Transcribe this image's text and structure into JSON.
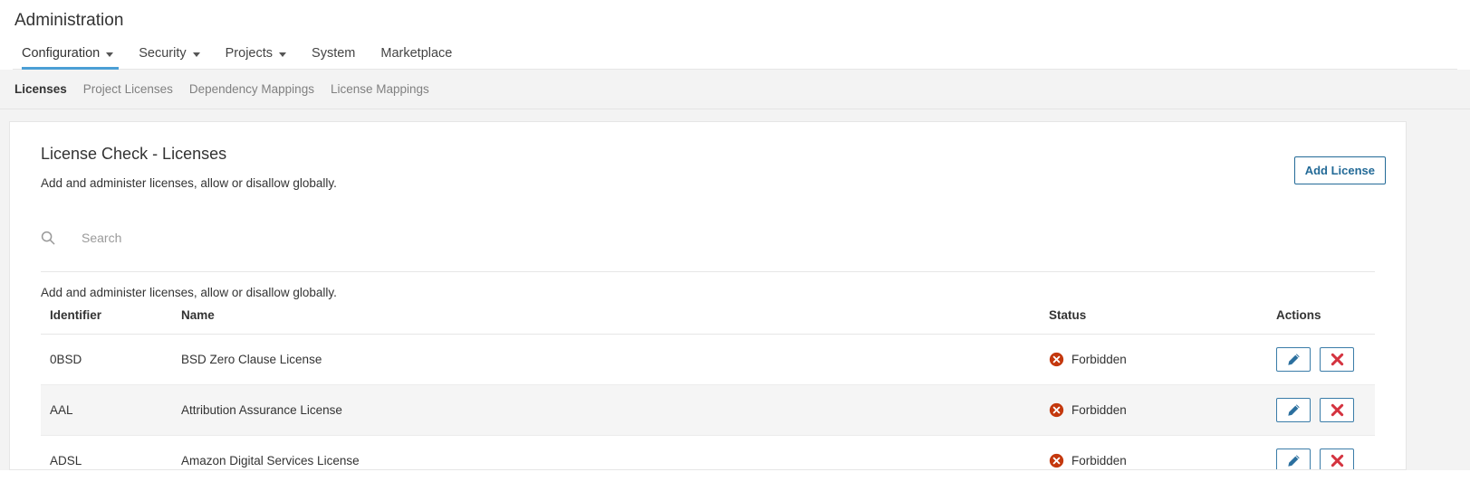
{
  "header": {
    "app_title": "Administration",
    "nav": [
      {
        "label": "Configuration",
        "has_caret": true,
        "active": true,
        "icon": "chevron-down-icon"
      },
      {
        "label": "Security",
        "has_caret": true,
        "active": false,
        "icon": "chevron-down-icon"
      },
      {
        "label": "Projects",
        "has_caret": true,
        "active": false,
        "icon": "chevron-down-icon"
      },
      {
        "label": "System",
        "has_caret": false,
        "active": false
      },
      {
        "label": "Marketplace",
        "has_caret": false,
        "active": false
      }
    ]
  },
  "sub_nav": [
    {
      "label": "Licenses",
      "active": true
    },
    {
      "label": "Project Licenses",
      "active": false
    },
    {
      "label": "Dependency Mappings",
      "active": false
    },
    {
      "label": "License Mappings",
      "active": false
    }
  ],
  "card": {
    "title": "License Check - Licenses",
    "subtitle": "Add and administer licenses, allow or disallow globally.",
    "add_button_label": "Add License"
  },
  "search": {
    "icon": "search-icon",
    "value": "",
    "placeholder": "Search"
  },
  "table": {
    "caption": "Add and administer licenses, allow or disallow globally.",
    "columns": [
      "Identifier",
      "Name",
      "Status",
      "Actions"
    ],
    "rows": [
      {
        "identifier": "0BSD",
        "name": "BSD Zero Clause License",
        "status": "Forbidden",
        "status_icon": "forbidden-icon",
        "edit_icon": "pencil-icon",
        "delete_icon": "close-x-icon"
      },
      {
        "identifier": "AAL",
        "name": "Attribution Assurance License",
        "status": "Forbidden",
        "status_icon": "forbidden-icon",
        "edit_icon": "pencil-icon",
        "delete_icon": "close-x-icon"
      },
      {
        "identifier": "ADSL",
        "name": "Amazon Digital Services License",
        "status": "Forbidden",
        "status_icon": "forbidden-icon",
        "edit_icon": "pencil-icon",
        "delete_icon": "close-x-icon"
      }
    ]
  },
  "colors": {
    "accent_blue": "#4b9fd5",
    "link_blue": "#236a97",
    "forbidden_red": "#c4380d",
    "delete_red": "#d4333f",
    "page_bg": "#f3f3f3",
    "row_alt_bg": "#f5f5f5"
  }
}
